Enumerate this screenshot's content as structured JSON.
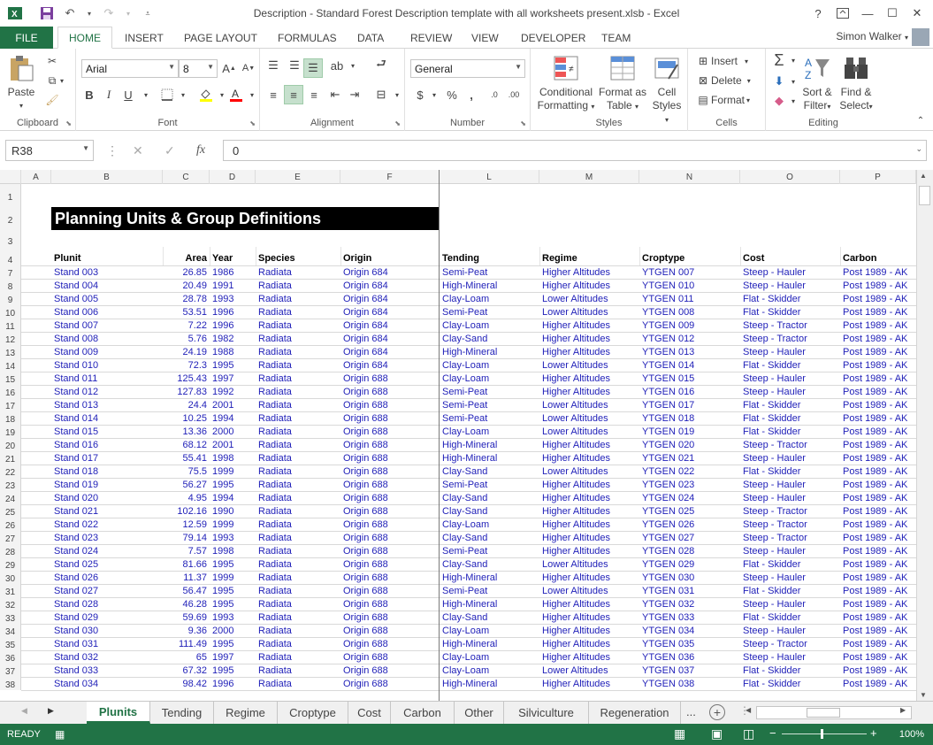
{
  "window": {
    "title": "Description - Standard Forest Description template with all worksheets present.xlsb - Excel",
    "help": "?",
    "user": "Simon Walker"
  },
  "ribbon_tabs": [
    "HOME",
    "INSERT",
    "PAGE LAYOUT",
    "FORMULAS",
    "DATA",
    "REVIEW",
    "VIEW",
    "DEVELOPER",
    "TEAM"
  ],
  "file_tab": "FILE",
  "ribbon": {
    "clipboard": {
      "label": "Clipboard",
      "paste": "Paste"
    },
    "font": {
      "label": "Font",
      "name": "Arial",
      "size": "8",
      "bold": "B",
      "italic": "I",
      "underline": "U"
    },
    "alignment": {
      "label": "Alignment"
    },
    "number": {
      "label": "Number",
      "format": "General",
      "currency": "$",
      "percent": "%",
      "comma": ","
    },
    "styles": {
      "label": "Styles",
      "conditional": [
        "Conditional",
        "Formatting"
      ],
      "format_table": [
        "Format as",
        "Table"
      ],
      "cell_styles": [
        "Cell",
        "Styles"
      ]
    },
    "cells": {
      "label": "Cells",
      "insert": "Insert",
      "delete": "Delete",
      "format": "Format"
    },
    "editing": {
      "label": "Editing",
      "sort": [
        "Sort &",
        "Filter"
      ],
      "find": [
        "Find &",
        "Select"
      ]
    }
  },
  "formula_bar": {
    "name_box": "R38",
    "value": "0",
    "fx": "fx"
  },
  "columns": [
    "A",
    "B",
    "C",
    "D",
    "E",
    "F",
    "L",
    "M",
    "N",
    "O",
    "P"
  ],
  "banner": "Planning Units & Group Definitions",
  "headers": [
    "Plunit",
    "Area",
    "Year",
    "Species",
    "Origin",
    "Tending",
    "Regime",
    "Croptype",
    "Cost",
    "Carbon"
  ],
  "header_row": "4",
  "top_rows": [
    "1",
    "2",
    "3"
  ],
  "rows": [
    {
      "n": "7",
      "plunit": "Stand 003",
      "area": "26.85",
      "year": "1986",
      "species": "Radiata",
      "origin": "Origin 684",
      "tending": "Semi-Peat",
      "regime": "Higher Altitudes",
      "crop": "YTGEN 007",
      "cost": "Steep - Hauler",
      "carbon": "Post 1989 - AK"
    },
    {
      "n": "8",
      "plunit": "Stand 004",
      "area": "20.49",
      "year": "1991",
      "species": "Radiata",
      "origin": "Origin 684",
      "tending": "High-Mineral",
      "regime": "Higher Altitudes",
      "crop": "YTGEN 010",
      "cost": "Steep - Hauler",
      "carbon": "Post 1989 - AK"
    },
    {
      "n": "9",
      "plunit": "Stand 005",
      "area": "28.78",
      "year": "1993",
      "species": "Radiata",
      "origin": "Origin 684",
      "tending": "Clay-Loam",
      "regime": "Lower Altitudes",
      "crop": "YTGEN 011",
      "cost": "Flat - Skidder",
      "carbon": "Post 1989 - AK"
    },
    {
      "n": "10",
      "plunit": "Stand 006",
      "area": "53.51",
      "year": "1996",
      "species": "Radiata",
      "origin": "Origin 684",
      "tending": "Semi-Peat",
      "regime": "Lower Altitudes",
      "crop": "YTGEN 008",
      "cost": "Flat - Skidder",
      "carbon": "Post 1989 - AK"
    },
    {
      "n": "11",
      "plunit": "Stand 007",
      "area": "7.22",
      "year": "1996",
      "species": "Radiata",
      "origin": "Origin 684",
      "tending": "Clay-Loam",
      "regime": "Higher Altitudes",
      "crop": "YTGEN 009",
      "cost": "Steep - Tractor",
      "carbon": "Post 1989 - AK"
    },
    {
      "n": "12",
      "plunit": "Stand 008",
      "area": "5.76",
      "year": "1982",
      "species": "Radiata",
      "origin": "Origin 684",
      "tending": "Clay-Sand",
      "regime": "Higher Altitudes",
      "crop": "YTGEN 012",
      "cost": "Steep - Tractor",
      "carbon": "Post 1989 - AK"
    },
    {
      "n": "13",
      "plunit": "Stand 009",
      "area": "24.19",
      "year": "1988",
      "species": "Radiata",
      "origin": "Origin 684",
      "tending": "High-Mineral",
      "regime": "Higher Altitudes",
      "crop": "YTGEN 013",
      "cost": "Steep - Hauler",
      "carbon": "Post 1989 - AK"
    },
    {
      "n": "14",
      "plunit": "Stand 010",
      "area": "72.3",
      "year": "1995",
      "species": "Radiata",
      "origin": "Origin 684",
      "tending": "Clay-Loam",
      "regime": "Lower Altitudes",
      "crop": "YTGEN 014",
      "cost": "Flat - Skidder",
      "carbon": "Post 1989 - AK"
    },
    {
      "n": "15",
      "plunit": "Stand 011",
      "area": "125.43",
      "year": "1997",
      "species": "Radiata",
      "origin": "Origin 688",
      "tending": "Clay-Loam",
      "regime": "Higher Altitudes",
      "crop": "YTGEN 015",
      "cost": "Steep - Hauler",
      "carbon": "Post 1989 - AK"
    },
    {
      "n": "16",
      "plunit": "Stand 012",
      "area": "127.83",
      "year": "1992",
      "species": "Radiata",
      "origin": "Origin 688",
      "tending": "Semi-Peat",
      "regime": "Higher Altitudes",
      "crop": "YTGEN 016",
      "cost": "Steep - Hauler",
      "carbon": "Post 1989 - AK"
    },
    {
      "n": "17",
      "plunit": "Stand 013",
      "area": "24.4",
      "year": "2001",
      "species": "Radiata",
      "origin": "Origin 688",
      "tending": "Semi-Peat",
      "regime": "Lower Altitudes",
      "crop": "YTGEN 017",
      "cost": "Flat - Skidder",
      "carbon": "Post 1989 - AK"
    },
    {
      "n": "18",
      "plunit": "Stand 014",
      "area": "10.25",
      "year": "1994",
      "species": "Radiata",
      "origin": "Origin 688",
      "tending": "Semi-Peat",
      "regime": "Lower Altitudes",
      "crop": "YTGEN 018",
      "cost": "Flat - Skidder",
      "carbon": "Post 1989 - AK"
    },
    {
      "n": "19",
      "plunit": "Stand 015",
      "area": "13.36",
      "year": "2000",
      "species": "Radiata",
      "origin": "Origin 688",
      "tending": "Clay-Loam",
      "regime": "Lower Altitudes",
      "crop": "YTGEN 019",
      "cost": "Flat - Skidder",
      "carbon": "Post 1989 - AK"
    },
    {
      "n": "20",
      "plunit": "Stand 016",
      "area": "68.12",
      "year": "2001",
      "species": "Radiata",
      "origin": "Origin 688",
      "tending": "High-Mineral",
      "regime": "Higher Altitudes",
      "crop": "YTGEN 020",
      "cost": "Steep - Tractor",
      "carbon": "Post 1989 - AK"
    },
    {
      "n": "21",
      "plunit": "Stand 017",
      "area": "55.41",
      "year": "1998",
      "species": "Radiata",
      "origin": "Origin 688",
      "tending": "High-Mineral",
      "regime": "Higher Altitudes",
      "crop": "YTGEN 021",
      "cost": "Steep - Hauler",
      "carbon": "Post 1989 - AK"
    },
    {
      "n": "22",
      "plunit": "Stand 018",
      "area": "75.5",
      "year": "1999",
      "species": "Radiata",
      "origin": "Origin 688",
      "tending": "Clay-Sand",
      "regime": "Lower Altitudes",
      "crop": "YTGEN 022",
      "cost": "Flat - Skidder",
      "carbon": "Post 1989 - AK"
    },
    {
      "n": "23",
      "plunit": "Stand 019",
      "area": "56.27",
      "year": "1995",
      "species": "Radiata",
      "origin": "Origin 688",
      "tending": "Semi-Peat",
      "regime": "Higher Altitudes",
      "crop": "YTGEN 023",
      "cost": "Steep - Hauler",
      "carbon": "Post 1989 - AK"
    },
    {
      "n": "24",
      "plunit": "Stand 020",
      "area": "4.95",
      "year": "1994",
      "species": "Radiata",
      "origin": "Origin 688",
      "tending": "Clay-Sand",
      "regime": "Higher Altitudes",
      "crop": "YTGEN 024",
      "cost": "Steep - Hauler",
      "carbon": "Post 1989 - AK"
    },
    {
      "n": "25",
      "plunit": "Stand 021",
      "area": "102.16",
      "year": "1990",
      "species": "Radiata",
      "origin": "Origin 688",
      "tending": "Clay-Sand",
      "regime": "Higher Altitudes",
      "crop": "YTGEN 025",
      "cost": "Steep - Tractor",
      "carbon": "Post 1989 - AK"
    },
    {
      "n": "26",
      "plunit": "Stand 022",
      "area": "12.59",
      "year": "1999",
      "species": "Radiata",
      "origin": "Origin 688",
      "tending": "Clay-Loam",
      "regime": "Higher Altitudes",
      "crop": "YTGEN 026",
      "cost": "Steep - Tractor",
      "carbon": "Post 1989 - AK"
    },
    {
      "n": "27",
      "plunit": "Stand 023",
      "area": "79.14",
      "year": "1993",
      "species": "Radiata",
      "origin": "Origin 688",
      "tending": "Clay-Sand",
      "regime": "Higher Altitudes",
      "crop": "YTGEN 027",
      "cost": "Steep - Tractor",
      "carbon": "Post 1989 - AK"
    },
    {
      "n": "28",
      "plunit": "Stand 024",
      "area": "7.57",
      "year": "1998",
      "species": "Radiata",
      "origin": "Origin 688",
      "tending": "Semi-Peat",
      "regime": "Higher Altitudes",
      "crop": "YTGEN 028",
      "cost": "Steep - Hauler",
      "carbon": "Post 1989 - AK"
    },
    {
      "n": "29",
      "plunit": "Stand 025",
      "area": "81.66",
      "year": "1995",
      "species": "Radiata",
      "origin": "Origin 688",
      "tending": "Clay-Sand",
      "regime": "Lower Altitudes",
      "crop": "YTGEN 029",
      "cost": "Flat - Skidder",
      "carbon": "Post 1989 - AK"
    },
    {
      "n": "30",
      "plunit": "Stand 026",
      "area": "11.37",
      "year": "1999",
      "species": "Radiata",
      "origin": "Origin 688",
      "tending": "High-Mineral",
      "regime": "Higher Altitudes",
      "crop": "YTGEN 030",
      "cost": "Steep - Hauler",
      "carbon": "Post 1989 - AK"
    },
    {
      "n": "31",
      "plunit": "Stand 027",
      "area": "56.47",
      "year": "1995",
      "species": "Radiata",
      "origin": "Origin 688",
      "tending": "Semi-Peat",
      "regime": "Lower Altitudes",
      "crop": "YTGEN 031",
      "cost": "Flat - Skidder",
      "carbon": "Post 1989 - AK"
    },
    {
      "n": "32",
      "plunit": "Stand 028",
      "area": "46.28",
      "year": "1995",
      "species": "Radiata",
      "origin": "Origin 688",
      "tending": "High-Mineral",
      "regime": "Higher Altitudes",
      "crop": "YTGEN 032",
      "cost": "Steep - Hauler",
      "carbon": "Post 1989 - AK"
    },
    {
      "n": "33",
      "plunit": "Stand 029",
      "area": "59.69",
      "year": "1993",
      "species": "Radiata",
      "origin": "Origin 688",
      "tending": "Clay-Sand",
      "regime": "Higher Altitudes",
      "crop": "YTGEN 033",
      "cost": "Flat - Skidder",
      "carbon": "Post 1989 - AK"
    },
    {
      "n": "34",
      "plunit": "Stand 030",
      "area": "9.36",
      "year": "2000",
      "species": "Radiata",
      "origin": "Origin 688",
      "tending": "Clay-Loam",
      "regime": "Higher Altitudes",
      "crop": "YTGEN 034",
      "cost": "Steep - Hauler",
      "carbon": "Post 1989 - AK"
    },
    {
      "n": "35",
      "plunit": "Stand 031",
      "area": "111.49",
      "year": "1995",
      "species": "Radiata",
      "origin": "Origin 688",
      "tending": "High-Mineral",
      "regime": "Higher Altitudes",
      "crop": "YTGEN 035",
      "cost": "Steep - Tractor",
      "carbon": "Post 1989 - AK"
    },
    {
      "n": "36",
      "plunit": "Stand 032",
      "area": "65",
      "year": "1997",
      "species": "Radiata",
      "origin": "Origin 688",
      "tending": "Clay-Loam",
      "regime": "Higher Altitudes",
      "crop": "YTGEN 036",
      "cost": "Steep - Hauler",
      "carbon": "Post 1989 - AK"
    },
    {
      "n": "37",
      "plunit": "Stand 033",
      "area": "67.32",
      "year": "1995",
      "species": "Radiata",
      "origin": "Origin 688",
      "tending": "Clay-Loam",
      "regime": "Lower Altitudes",
      "crop": "YTGEN 037",
      "cost": "Flat - Skidder",
      "carbon": "Post 1989 - AK"
    },
    {
      "n": "38",
      "plunit": "Stand 034",
      "area": "98.42",
      "year": "1996",
      "species": "Radiata",
      "origin": "Origin 688",
      "tending": "High-Mineral",
      "regime": "Higher Altitudes",
      "crop": "YTGEN 038",
      "cost": "Flat - Skidder",
      "carbon": "Post 1989 - AK"
    }
  ],
  "sheet_tabs": [
    "Plunits",
    "Tending",
    "Regime",
    "Croptype",
    "Cost",
    "Carbon",
    "Other",
    "Silviculture",
    "Regeneration"
  ],
  "active_sheet": "Plunits",
  "more_tabs": "...",
  "status": {
    "ready": "READY",
    "zoom": "100%"
  },
  "colors": {
    "accent": "#217346",
    "cell_text": "#1f1fb8",
    "banner_bg": "#000000"
  }
}
